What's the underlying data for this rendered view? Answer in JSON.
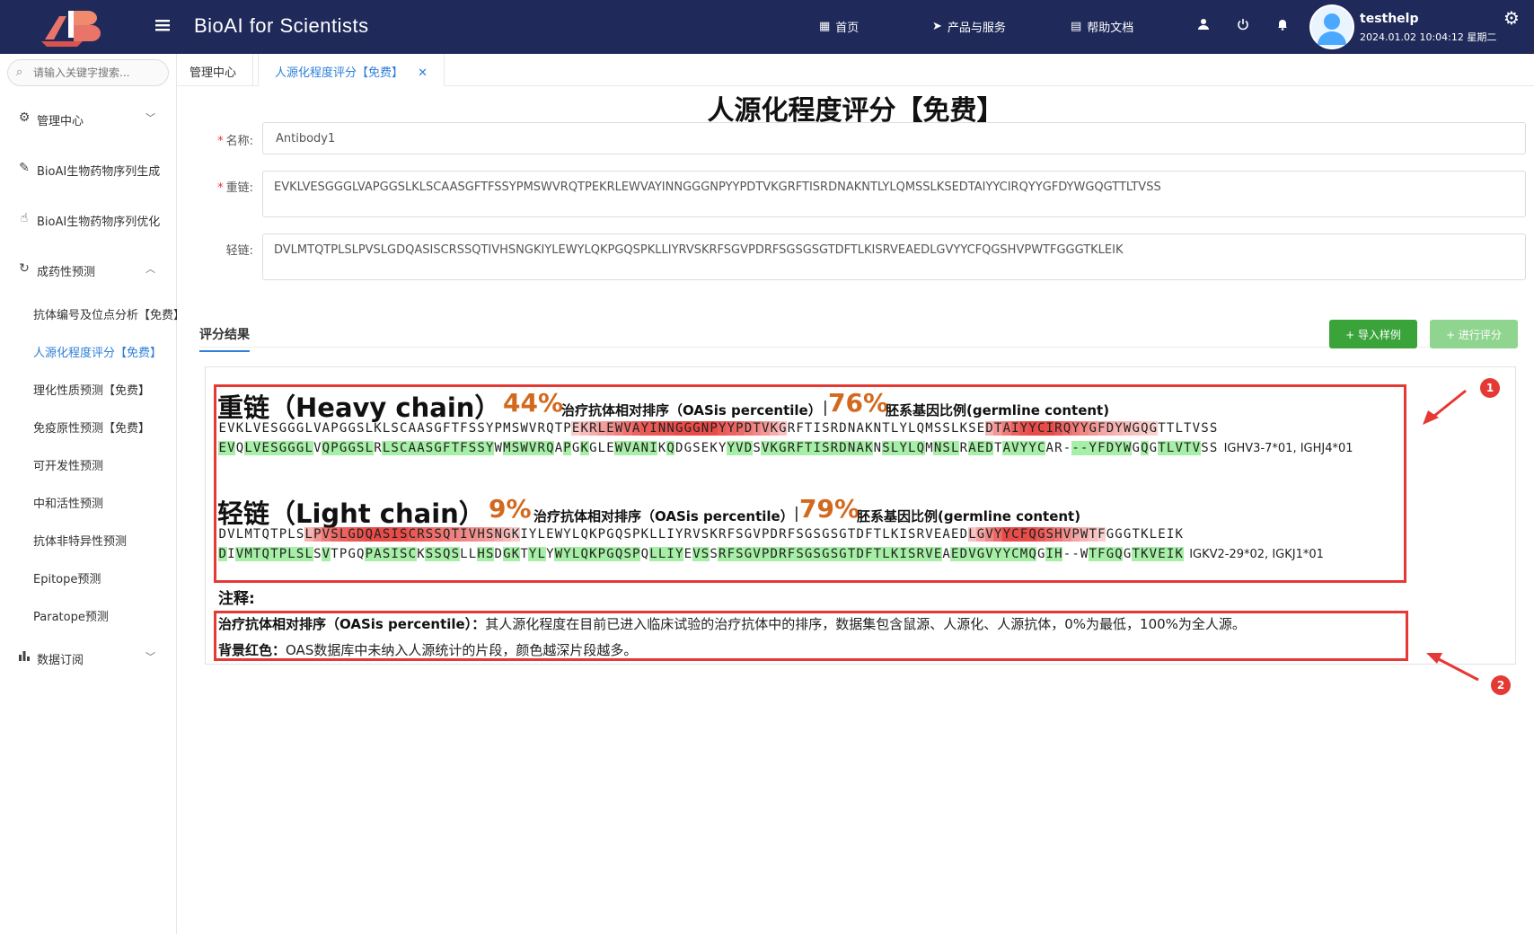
{
  "header": {
    "app_title": "BioAI for Scientists",
    "nav": [
      {
        "icon": "grid-icon",
        "glyph": "▦",
        "label": "首页"
      },
      {
        "icon": "send-icon",
        "glyph": "➤",
        "label": "产品与服务"
      },
      {
        "icon": "document-icon",
        "glyph": "▤",
        "label": "帮助文档"
      }
    ],
    "user_name": "testhelp",
    "user_time": "2024.01.02 10:04:12 星期二"
  },
  "sidebar": {
    "search_placeholder": "请输入关键字搜索...",
    "groups": [
      {
        "label": "管理中心"
      },
      {
        "label": "BioAI生物药物序列生成"
      },
      {
        "label": "BioAI生物药物序列优化"
      },
      {
        "label": "成药性预测"
      },
      {
        "label": "数据订阅"
      }
    ],
    "sub_items": [
      {
        "label": "抗体编号及位点分析【免费】"
      },
      {
        "label": "人源化程度评分【免费】"
      },
      {
        "label": "理化性质预测【免费】"
      },
      {
        "label": "免疫原性预测【免费】"
      },
      {
        "label": "可开发性预测"
      },
      {
        "label": "中和活性预测"
      },
      {
        "label": "抗体非特异性预测"
      },
      {
        "label": "Epitope预测"
      },
      {
        "label": "Paratope预测"
      }
    ]
  },
  "tabs": [
    {
      "label": "管理中心"
    },
    {
      "label": "人源化程度评分【免费】"
    }
  ],
  "form": {
    "title": "人源化程度评分【免费】",
    "name_label": "名称:",
    "name_value": "Antibody1",
    "heavy_label": "重链:",
    "heavy_value": "EVKLVESGGGLVAPGGSLKLSCAASGFTFSSYPMSWVRQTPEKRLEWVAYINNGGGNPYYPDTVKGRFTISRDNAKNTLYLQMSSLKSEDTAIYYCIRQYYGFDYWGQGTTLTVSS",
    "light_label": "轻链:",
    "light_value": "DVLMTQTPLSLPVSLGDQASISCRSSQTIVHSNGKIYLEWYLQKPGQSPKLLIYRVSKRFSGVPDRFSGSGSGTDFTLKISRVEAEDLGVYYCFQGSHVPWTFGGGTKLEIK"
  },
  "result": {
    "section_label": "评分结果",
    "import_button": "+ 导入样例",
    "score_button": "+ 进行评分",
    "heavy": {
      "title": "重链（Heavy chain）",
      "oasis_pct": "44%",
      "oasis_label": "治疗抗体相对排序（OASis percentile）",
      "sep": "|",
      "germline_pct": "76%",
      "germline_label": "胚系基因比例(germline content)",
      "query_seq": "EVKLVESGGGLVAPGGSLKLSCAASGFTFSSYPMSWVRQTPEKRLEWVAYINNGGGNPYYPDTVKGRFTISRDNAKNTLYLQMSSLKSEDTAIYYCIRQYYGFDYWGQGTTLTVSS",
      "germ_seq": "EVQLVESGGGLVQPGGSLRLSCAASGFTFSSYWMSWVRQAPGKGLEWVANIKQDGSEKYYVDSVKGRFTISRDNAKNSLYLQMNSLRAEDTAVYYCAR---YFDYWGQGTLVTVSS",
      "germ_genes": "IGHV3-7*01, IGHJ4*01"
    },
    "light": {
      "title": "轻链（Light chain）",
      "oasis_pct": "9%",
      "oasis_label": "治疗抗体相对排序（OASis percentile）",
      "sep": "|",
      "germline_pct": "79%",
      "germline_label": "胚系基因比例(germline content)",
      "query_seq": "DVLMTQTPLSLPVSLGDQASISCRSSQTIVHSNGKIYLEWYLQKPGQSPKLLIYRVSKRFSGVPDRFSGSGSGTDFTLKISRVEAEDLGVYYCFQGSHVPWTFGGGTKLEIK",
      "germ_seq": "DIVMTQTPLSLSVTPGQPASISCKSSQSLLHSDGKTYLYWYLQKPGQSPQLLIYEVSSRFSGVPDRFSGSGSGTDFTLKISRVEAEDVGVYYCMQGIH--WTFGQGTKVEIK",
      "germ_genes": "IGKV2-29*02, IGKJ1*01"
    },
    "notes_title": "注释:",
    "note1_bold": "治疗抗体相对排序（OASis percentile）：",
    "note1_text": "其人源化程度在目前已进入临床试验的治疗抗体中的排序，数据集包含鼠源、人源化、人源抗体，0%为最低，100%为全人源。",
    "note2_bold": "背景红色：",
    "note2_text": "OAS数据库中未纳入人源统计的片段，颜色越深片段越多。"
  },
  "annotations": {
    "callout_1": "1",
    "callout_2": "2"
  },
  "colors": {
    "topbar": "#1f2a5a",
    "accent": "#2f7fd9",
    "green_button": "#3aa33a",
    "percent": "#d2691e",
    "highlight_red": "#e53935",
    "highlight_green": "#a6efa6"
  },
  "highlights": {
    "heavy_red": [
      0,
      0,
      0,
      0,
      0,
      0,
      0,
      0,
      0,
      0,
      0,
      0,
      0,
      0,
      0,
      0,
      0,
      0,
      0,
      0,
      0,
      0,
      0,
      0,
      0,
      0,
      0,
      0,
      0,
      0,
      0,
      0,
      0,
      0,
      0,
      0,
      0,
      0,
      0,
      0,
      0,
      0.15,
      0.25,
      0.35,
      0.45,
      0.55,
      0.65,
      0.75,
      0.85,
      0.9,
      0.9,
      0.95,
      0.95,
      1,
      1,
      1,
      1,
      1,
      0.9,
      0.85,
      0.8,
      0.7,
      0.6,
      0.5,
      0.35,
      0.2,
      0,
      0,
      0,
      0,
      0,
      0,
      0,
      0,
      0,
      0,
      0,
      0,
      0,
      0,
      0,
      0,
      0,
      0,
      0,
      0,
      0,
      0,
      0,
      0.3,
      0.5,
      0.7,
      0.85,
      0.95,
      1,
      1,
      1,
      0.9,
      0.8,
      0.7,
      0.6,
      0.5,
      0.4,
      0.35,
      0.3,
      0.25,
      0.2,
      0.15,
      0.1,
      0,
      0,
      0,
      0,
      0,
      0,
      0,
      0,
      0,
      0,
      0
    ],
    "heavy_green": [
      1,
      1,
      0,
      1,
      1,
      1,
      1,
      1,
      1,
      1,
      1,
      0,
      1,
      1,
      1,
      1,
      1,
      1,
      0,
      1,
      1,
      1,
      1,
      1,
      1,
      1,
      1,
      1,
      1,
      1,
      1,
      1,
      0,
      1,
      1,
      1,
      1,
      1,
      1,
      0,
      1,
      0,
      1,
      0,
      0,
      0,
      1,
      1,
      1,
      1,
      1,
      0,
      1,
      0,
      0,
      0,
      0,
      0,
      0,
      1,
      1,
      1,
      0,
      1,
      1,
      1,
      1,
      1,
      1,
      1,
      1,
      1,
      1,
      1,
      1,
      1,
      0,
      1,
      1,
      1,
      1,
      1,
      0,
      1,
      1,
      1,
      0,
      1,
      1,
      1,
      0,
      1,
      1,
      1,
      1,
      1,
      0,
      0,
      0,
      1,
      1,
      1,
      1,
      1,
      1,
      1,
      0,
      1,
      0,
      1,
      1,
      1,
      1,
      1
    ],
    "light_red": [
      0,
      0,
      0,
      0,
      0,
      0,
      0,
      0,
      0,
      0,
      0.3,
      0.5,
      0.7,
      0.8,
      0.85,
      0.9,
      0.95,
      1,
      1,
      1,
      1,
      1,
      0.9,
      0.85,
      0.8,
      0.75,
      0.7,
      0.65,
      0.6,
      0.55,
      0.5,
      0.45,
      0.35,
      0.25,
      0.15,
      0,
      0,
      0,
      0,
      0,
      0,
      0,
      0,
      0,
      0,
      0,
      0,
      0,
      0,
      0,
      0,
      0,
      0,
      0,
      0,
      0,
      0,
      0,
      0,
      0,
      0,
      0,
      0,
      0,
      0,
      0,
      0,
      0,
      0,
      0,
      0,
      0,
      0,
      0,
      0,
      0,
      0,
      0,
      0,
      0,
      0,
      0,
      0,
      0,
      0,
      0,
      0,
      0.2,
      0.4,
      0.6,
      0.8,
      1,
      1,
      1,
      1,
      0.9,
      0.8,
      0.7,
      0.55,
      0.4,
      0.3,
      0.2,
      0.1,
      0,
      0,
      0,
      0,
      0,
      0,
      0,
      0,
      0
    ],
    "light_green": [
      1,
      0,
      1,
      1,
      1,
      1,
      1,
      1,
      1,
      1,
      1,
      0,
      1,
      0,
      0,
      0,
      0,
      1,
      1,
      1,
      1,
      1,
      1,
      0,
      1,
      1,
      1,
      1,
      0,
      0,
      1,
      1,
      0,
      1,
      1,
      0,
      1,
      1,
      0,
      1,
      1,
      1,
      1,
      1,
      1,
      1,
      1,
      1,
      1,
      0,
      1,
      1,
      1,
      1,
      0,
      1,
      1,
      0,
      1,
      1,
      1,
      1,
      1,
      1,
      1,
      1,
      1,
      1,
      1,
      1,
      1,
      1,
      1,
      1,
      1,
      1,
      1,
      1,
      1,
      1,
      1,
      1,
      1,
      1,
      0,
      1,
      1,
      1,
      1,
      1,
      1,
      1,
      1,
      1,
      1,
      0,
      1,
      1,
      0,
      0,
      0,
      1,
      1,
      1,
      1,
      0,
      1,
      1,
      1,
      1,
      1,
      1
    ]
  }
}
